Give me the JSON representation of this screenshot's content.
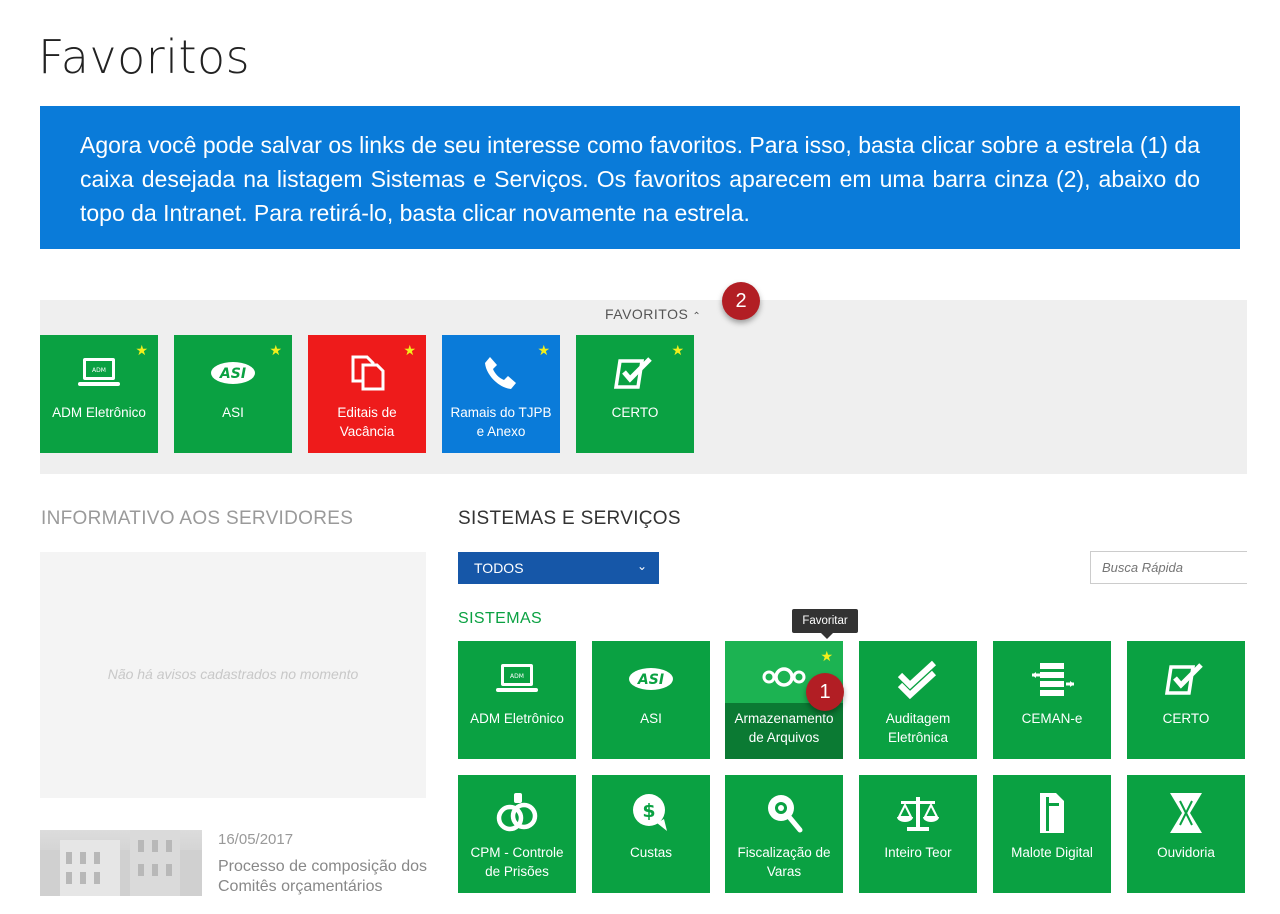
{
  "page": {
    "title": "Favoritos"
  },
  "banner": {
    "text": "Agora você pode salvar os links de seu interesse como favoritos. Para isso, basta clicar sobre a estrela (1) da caixa desejada na listagem Sistemas e Serviços. Os favoritos aparecem em uma barra cinza (2), abaixo do topo da Intranet. Para retirá-lo, basta clicar novamente na estrela."
  },
  "favorites_bar": {
    "header": "FAVORITOS",
    "marker": "2",
    "items": [
      {
        "label_1": "ADM Eletrônico",
        "label_2": "",
        "icon": "laptop-icon",
        "color": "#0aa142"
      },
      {
        "label_1": "ASI",
        "label_2": "",
        "icon": "asi-logo-icon",
        "color": "#0aa142"
      },
      {
        "label_1": "Editais de",
        "label_2": "Vacância",
        "icon": "documents-icon",
        "color": "#ee1b1b"
      },
      {
        "label_1": "Ramais do TJPB",
        "label_2": "e Anexo",
        "icon": "phone-icon",
        "color": "#0a7bd9"
      },
      {
        "label_1": "CERTO",
        "label_2": "",
        "icon": "checkbox-icon",
        "color": "#0aa142"
      }
    ]
  },
  "informativo": {
    "title": "INFORMATIVO AOS SERVIDORES",
    "empty_text": "Não há avisos cadastrados no momento",
    "news": {
      "date": "16/05/2017",
      "title": "Processo de composição dos Comitês orçamentários"
    }
  },
  "sistemas": {
    "title": "SISTEMAS E SERVIÇOS",
    "filter_value": "TODOS",
    "search_placeholder": "Busca Rápida",
    "subtitle": "SISTEMAS",
    "tooltip": "Favoritar",
    "marker": "1",
    "row1": [
      {
        "label_1": "ADM Eletrônico",
        "label_2": "",
        "icon": "laptop-icon"
      },
      {
        "label_1": "ASI",
        "label_2": "",
        "icon": "asi-logo-icon"
      },
      {
        "label_1": "Armazenamento",
        "label_2": "de Arquivos",
        "icon": "nextcloud-icon"
      },
      {
        "label_1": "Auditagem",
        "label_2": "Eletrônica",
        "icon": "double-check-icon"
      },
      {
        "label_1": "CEMAN-e",
        "label_2": "",
        "icon": "server-arrows-icon"
      },
      {
        "label_1": "CERTO",
        "label_2": "",
        "icon": "checkbox-icon"
      }
    ],
    "row2": [
      {
        "label_1": "CPM - Controle",
        "label_2": "de Prisões",
        "icon": "handcuffs-icon"
      },
      {
        "label_1": "Custas",
        "label_2": "",
        "icon": "money-bubble-icon"
      },
      {
        "label_1": "Fiscalização de",
        "label_2": "Varas",
        "icon": "magnifier-icon"
      },
      {
        "label_1": "Inteiro Teor",
        "label_2": "",
        "icon": "scales-icon"
      },
      {
        "label_1": "Malote Digital",
        "label_2": "",
        "icon": "binder-icon"
      },
      {
        "label_1": "Ouvidoria",
        "label_2": "",
        "icon": "ouvidoria-logo-icon"
      }
    ]
  },
  "colors": {
    "green": "#0aa142",
    "blue": "#0a7bd9",
    "red": "#ee1b1b",
    "navy": "#1657a8",
    "star": "#f2ee1c",
    "marker": "#b21e24"
  }
}
